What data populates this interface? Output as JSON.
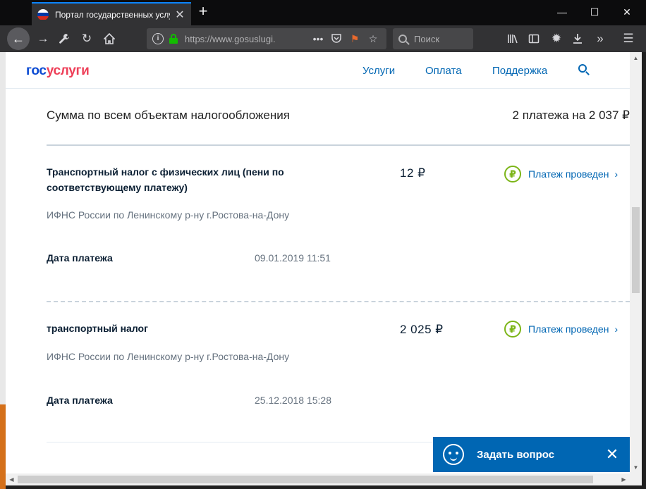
{
  "browser": {
    "tab_title": "Портал государственных услуг",
    "tab_close": "✕",
    "new_tab": "+",
    "url": "https://www.gosuslugi.",
    "search_placeholder": "Поиск",
    "window_controls": {
      "minimize": "—",
      "maximize": "☐",
      "close": "✕"
    },
    "icons": [
      "back-icon",
      "forward-icon",
      "wrench-icon",
      "reload-icon",
      "home-icon",
      "library-icon",
      "reader-icon",
      "gear-icon",
      "download-icon",
      "overflow-icon",
      "menu-icon"
    ]
  },
  "site": {
    "logo_part1": "гос",
    "logo_part2": "услуги",
    "nav": [
      "Услуги",
      "Оплата",
      "Поддержка"
    ]
  },
  "summary": {
    "label": "Сумма по всем объектам налогообложения",
    "value": "2 платежа на 2 037 ₽"
  },
  "payments": [
    {
      "title": "Транспортный налог с физических лиц (пени по соответствующему платежу)",
      "amount": "12 ₽",
      "status": "Платеж проведен",
      "org": "ИФНС России по Ленинскому р-ну г.Ростова-на-Дону",
      "date_label": "Дата платежа",
      "date": "09.01.2019 11:51"
    },
    {
      "title": "транспортный налог",
      "amount": "2 025 ₽",
      "status": "Платеж проведен",
      "org": "ИФНС России по Ленинскому р-ну г.Ростова-на-Дону",
      "date_label": "Дата платежа",
      "date": "25.12.2018 15:28"
    }
  ],
  "chat": {
    "label": "Задать вопрос",
    "close": "✕"
  },
  "colors": {
    "brand_blue": "#0066b3",
    "logo_blue": "#0d4cd3",
    "logo_red": "#ee3f58",
    "status_green": "#7cb518"
  }
}
